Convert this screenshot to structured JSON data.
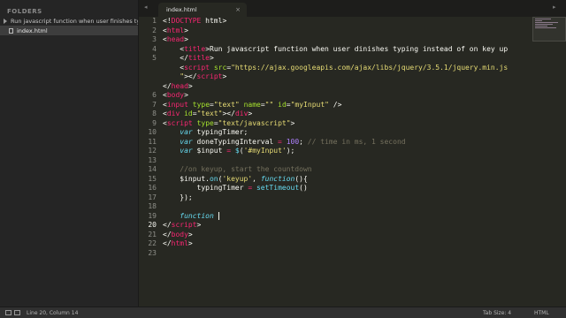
{
  "sidebar": {
    "header": "FOLDERS",
    "folder_name": "Run javascript function when user finishes typin",
    "file_name": "index.html"
  },
  "tabs": [
    {
      "label": "index.html",
      "close_glyph": "×"
    }
  ],
  "editor": {
    "active_line": 20,
    "line_numbers": [
      "1",
      "2",
      "3",
      "4",
      "5",
      "",
      "",
      "",
      "6",
      "7",
      "8",
      "9",
      "10",
      "11",
      "12",
      "13",
      "14",
      "15",
      "16",
      "17",
      "18",
      "19",
      "20",
      "21",
      "22",
      "23"
    ]
  },
  "status": {
    "position": "Line 20, Column 14",
    "tab_size": "Tab Size: 4",
    "syntax": "HTML"
  },
  "colors": {
    "editor_bg": "#272822",
    "tag": "#f92672",
    "attribute": "#a6e22e",
    "string": "#e6db74",
    "keyword": "#66d9ef",
    "number": "#ae81ff",
    "comment": "#75715e"
  }
}
